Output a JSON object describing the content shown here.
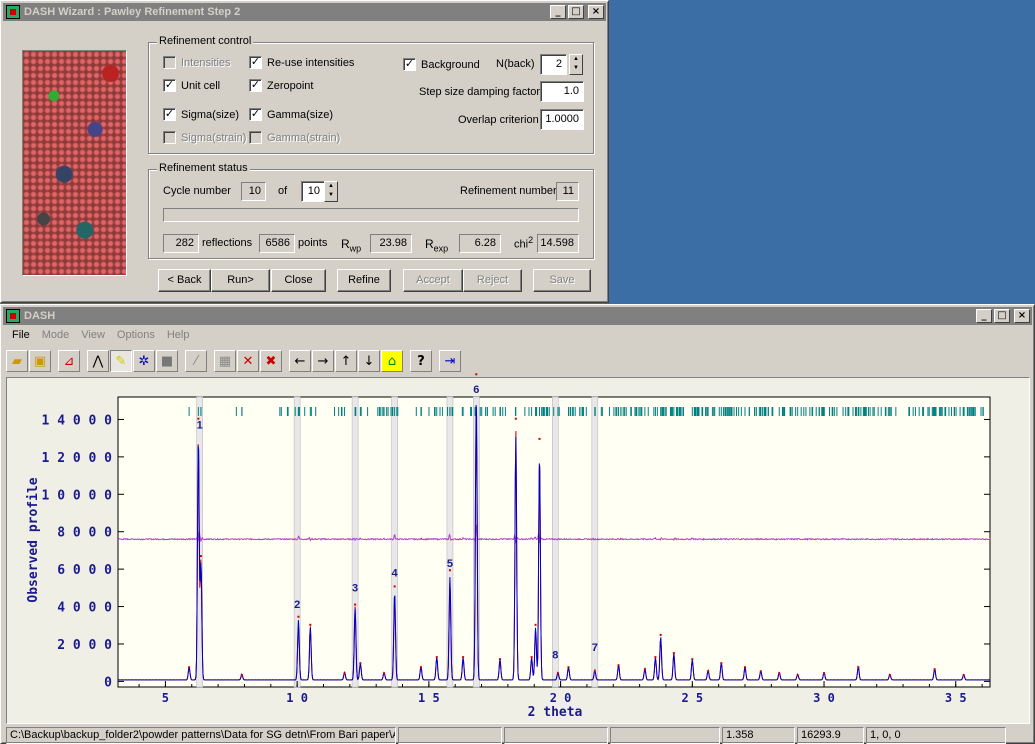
{
  "wizard": {
    "title": "DASH Wizard : Pawley Refinement Step 2",
    "refinement_control": {
      "label": "Refinement control",
      "intensities": "Intensities",
      "reuse_intensities": "Re-use intensities",
      "unit_cell": "Unit cell",
      "zeropoint": "Zeropoint",
      "sigma_size": "Sigma(size)",
      "gamma_size": "Gamma(size)",
      "sigma_strain": "Sigma(strain)",
      "gamma_strain": "Gamma(strain)",
      "background": "Background",
      "n_back_label": "N(back)",
      "n_back_value": "2",
      "step_damping_label": "Step size damping factor",
      "step_damping_value": "1.0",
      "overlap_label": "Overlap criterion",
      "overlap_value": "1.0000"
    },
    "refinement_status": {
      "label": "Refinement status",
      "cycle_label": "Cycle number",
      "cycle_value": "10",
      "of_label": "of",
      "of_value": "10",
      "refinement_number_label": "Refinement number",
      "refinement_number_value": "11",
      "reflections_value": "282",
      "reflections_label": "reflections",
      "points_value": "6586",
      "points_label": "points",
      "rwp_label": "R",
      "rwp_sub": "wp",
      "rwp_value": "23.98",
      "rexp_label": "R",
      "rexp_sub": "exp",
      "rexp_value": "6.28",
      "chi2_label": "chi",
      "chi2_sup": "2",
      "chi2_value": "14.598"
    },
    "buttons": {
      "back": "< Back",
      "run": "Run>",
      "close": "Close",
      "refine": "Refine",
      "accept": "Accept",
      "reject": "Reject",
      "save": "Save"
    }
  },
  "main": {
    "title": "DASH",
    "menu": [
      "File",
      "Mode",
      "View",
      "Options",
      "Help"
    ],
    "statusbar": {
      "path": "C:\\Backup\\backup_folder2\\powder patterns\\Data for SG detn\\From Bari paper\\A",
      "field2": "",
      "field3": "",
      "field4": "",
      "value1": "1.358",
      "value2": "16293.9",
      "value3": "1,  0,  0"
    }
  },
  "colors": {
    "observed": "#0000cc",
    "calc": "#cc0000",
    "difference": "#aa44cc",
    "ticks": "#008080",
    "axis_text": "#1a1a8c"
  },
  "chart_data": {
    "type": "line",
    "ylabel": "Observed  profile",
    "xlabel": "2  theta",
    "xlim": [
      3.2,
      36.3
    ],
    "ylim": [
      -300,
      15200
    ],
    "x_ticks": [
      5,
      10,
      15,
      20,
      25,
      30,
      35
    ],
    "y_ticks": [
      0,
      2000,
      4000,
      6000,
      8000,
      10000,
      12000,
      14000
    ],
    "y_tick_labels": [
      "0",
      "2 0 0 0",
      "4 0 0 0",
      "6 0 0 0",
      "8 0 0 0",
      "1 0 0 0 0",
      "1 2 0 0 0",
      "1 4 0 0 0"
    ],
    "x_tick_labels": [
      "5",
      "1 0",
      "1 5",
      "2 0",
      "2 5",
      "3 0",
      "3 5"
    ],
    "difference_offset": 7600,
    "peaks": [
      {
        "x": 5.9,
        "y": 700
      },
      {
        "x": 6.25,
        "y": 13000
      },
      {
        "x": 6.35,
        "y": 6200
      },
      {
        "x": 7.9,
        "y": 300
      },
      {
        "x": 10.05,
        "y": 3200
      },
      {
        "x": 10.5,
        "y": 2800
      },
      {
        "x": 11.8,
        "y": 400
      },
      {
        "x": 12.2,
        "y": 3800
      },
      {
        "x": 12.4,
        "y": 900
      },
      {
        "x": 13.3,
        "y": 400
      },
      {
        "x": 13.7,
        "y": 4700
      },
      {
        "x": 14.7,
        "y": 700
      },
      {
        "x": 15.3,
        "y": 1200
      },
      {
        "x": 15.8,
        "y": 5500
      },
      {
        "x": 16.3,
        "y": 1200
      },
      {
        "x": 16.8,
        "y": 15200
      },
      {
        "x": 17.7,
        "y": 1100
      },
      {
        "x": 18.3,
        "y": 13000
      },
      {
        "x": 18.9,
        "y": 1200
      },
      {
        "x": 19.05,
        "y": 2800
      },
      {
        "x": 19.2,
        "y": 12000
      },
      {
        "x": 19.9,
        "y": 400
      },
      {
        "x": 20.3,
        "y": 700
      },
      {
        "x": 21.3,
        "y": 500
      },
      {
        "x": 22.2,
        "y": 800
      },
      {
        "x": 23.2,
        "y": 600
      },
      {
        "x": 23.6,
        "y": 1200
      },
      {
        "x": 23.8,
        "y": 2300
      },
      {
        "x": 24.3,
        "y": 1400
      },
      {
        "x": 25.0,
        "y": 1100
      },
      {
        "x": 25.6,
        "y": 500
      },
      {
        "x": 26.1,
        "y": 900
      },
      {
        "x": 27.0,
        "y": 700
      },
      {
        "x": 27.6,
        "y": 500
      },
      {
        "x": 28.3,
        "y": 400
      },
      {
        "x": 29.0,
        "y": 300
      },
      {
        "x": 30.0,
        "y": 400
      },
      {
        "x": 31.3,
        "y": 700
      },
      {
        "x": 32.5,
        "y": 300
      },
      {
        "x": 34.2,
        "y": 600
      },
      {
        "x": 35.3,
        "y": 300
      }
    ],
    "peak_labels": [
      {
        "text": "1",
        "x": 6.3,
        "y": 13300
      },
      {
        "text": "2",
        "x": 10.0,
        "y": 3700
      },
      {
        "text": "3",
        "x": 12.2,
        "y": 4600
      },
      {
        "text": "4",
        "x": 13.7,
        "y": 5400
      },
      {
        "text": "5",
        "x": 15.8,
        "y": 5900
      },
      {
        "text": "6",
        "x": 16.8,
        "y": 15200
      },
      {
        "text": "8",
        "x": 19.8,
        "y": 1000
      },
      {
        "text": "7",
        "x": 21.3,
        "y": 1400
      }
    ],
    "excluded_regions": [
      6.3,
      10.0,
      12.2,
      13.7,
      15.8,
      16.8,
      19.8,
      21.3
    ]
  }
}
